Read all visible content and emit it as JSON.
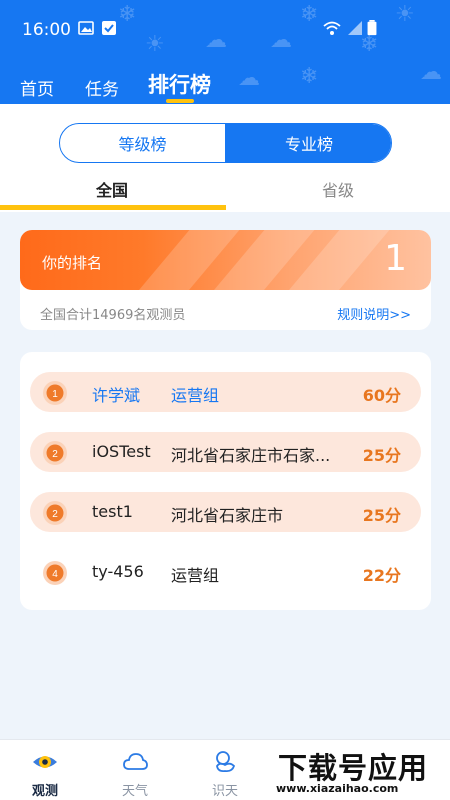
{
  "status_bar": {
    "time": "16:00"
  },
  "top_nav": {
    "tabs": [
      {
        "label": "首页"
      },
      {
        "label": "任务"
      },
      {
        "label": "排行榜",
        "active": true
      }
    ]
  },
  "segment": {
    "left": "等级榜",
    "right": "专业榜",
    "active": "right"
  },
  "scope_tabs": {
    "national": "全国",
    "province": "省级",
    "active": "national"
  },
  "my_rank": {
    "label": "你的排名",
    "value": "1",
    "total_text": "全国合计14969名观测员",
    "rules_link": "规则说明>>"
  },
  "leaderboard": [
    {
      "rank": "1",
      "name": "许学斌",
      "group": "运营组",
      "score": "60分",
      "highlight": true,
      "name_color": "#1677f2"
    },
    {
      "rank": "2",
      "name": "iOSTest",
      "group": "河北省石家庄市石家...",
      "score": "25分",
      "highlight": true
    },
    {
      "rank": "2",
      "name": "test1",
      "group": "河北省石家庄市",
      "score": "25分",
      "highlight": true
    },
    {
      "rank": "4",
      "name": "ty-456",
      "group": "运营组",
      "score": "22分",
      "highlight": false
    }
  ],
  "bottom_nav": [
    {
      "label": "观测",
      "icon": "eye-icon",
      "active": true
    },
    {
      "label": "天气",
      "icon": "cloud-icon"
    },
    {
      "label": "识天",
      "icon": "identify-sky-icon"
    }
  ],
  "watermark": {
    "big": "下载号应用",
    "small": "www.xiazaihao.com"
  },
  "colors": {
    "primary": "#1677f2",
    "accent": "#ffc20e",
    "rank_orange": "#ff6a1a",
    "score": "#e8761f",
    "highlight_row": "#fde7dc"
  }
}
